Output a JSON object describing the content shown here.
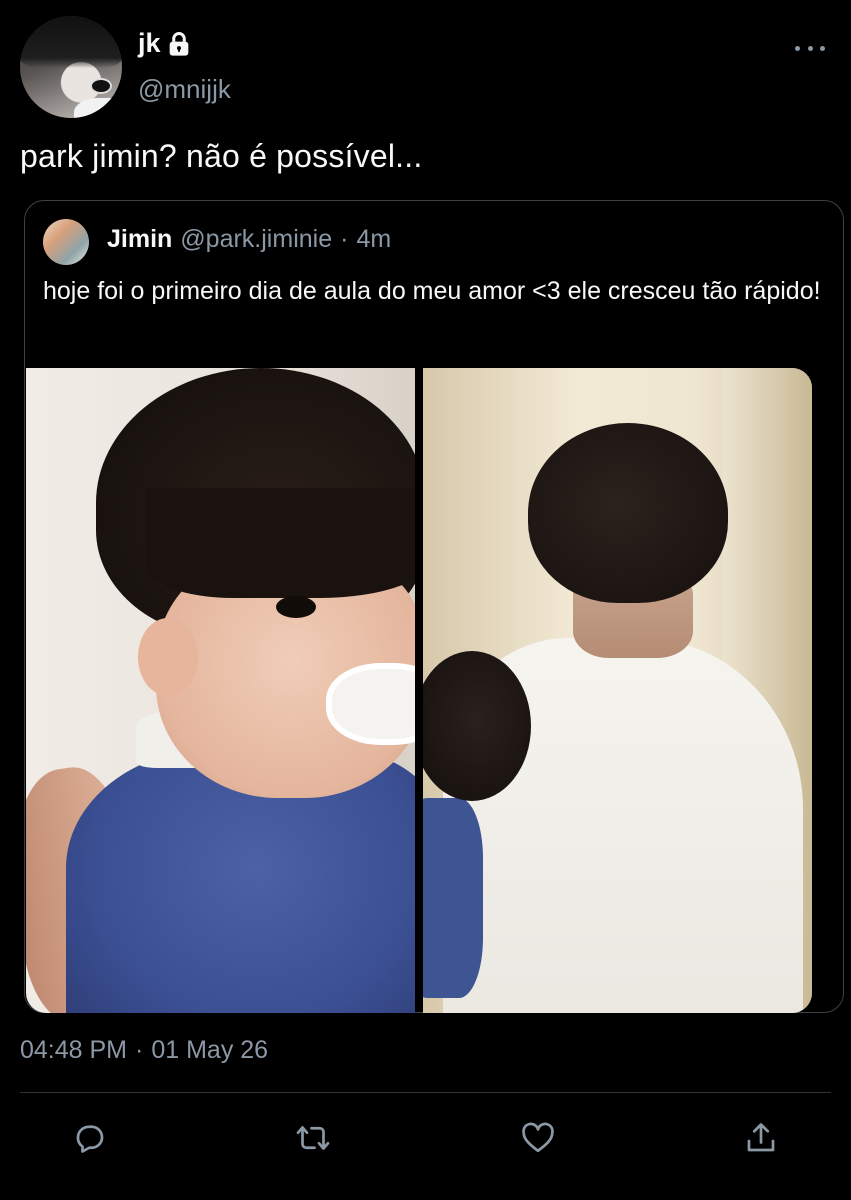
{
  "author": {
    "display_name": "jk",
    "handle": "@mnijjk",
    "protected": true
  },
  "tweet": {
    "text": "park jimin? não é possível...",
    "timestamp": "04:48 PM",
    "date_separator": "·",
    "date": "01 May 26"
  },
  "quote": {
    "display_name": "Jimin",
    "handle": "@park.jiminie",
    "separator": "·",
    "time": "4m",
    "text": "hoje foi o primeiro dia de aula do meu amor <3 ele cresceu tão rápido!",
    "media_count": 2
  },
  "actions": [
    {
      "name": "reply-icon"
    },
    {
      "name": "retweet-icon"
    },
    {
      "name": "like-icon"
    },
    {
      "name": "share-icon"
    }
  ],
  "colors": {
    "background": "#000000",
    "primary_text": "#f7f9f9",
    "secondary_text": "#8b98a5",
    "border": "#3e4144"
  }
}
